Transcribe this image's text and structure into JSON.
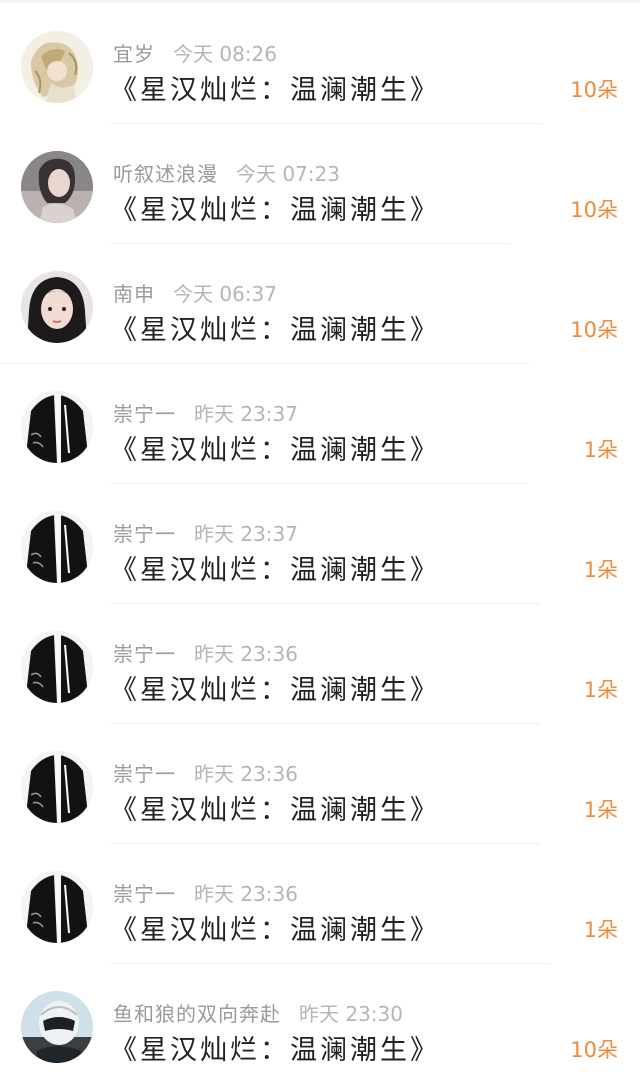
{
  "gifts": [
    {
      "user": "宜岁",
      "time": "今天 08:26",
      "title": "《星汉灿烂：温澜潮生》",
      "amount": "10朵",
      "avatar": "sketch-couple"
    },
    {
      "user": "听叙述浪漫",
      "time": "今天 07:23",
      "title": "《星汉灿烂：温澜潮生》",
      "amount": "10朵",
      "avatar": "girl-portrait"
    },
    {
      "user": "南申",
      "time": "今天 06:37",
      "title": "《星汉灿烂：温澜潮生》",
      "amount": "10朵",
      "avatar": "girl-dark-hair"
    },
    {
      "user": "崇宁一",
      "time": "昨天 23:37",
      "title": "《星汉灿烂：温澜潮生》",
      "amount": "1朵",
      "avatar": "black-robe"
    },
    {
      "user": "崇宁一",
      "time": "昨天 23:37",
      "title": "《星汉灿烂：温澜潮生》",
      "amount": "1朵",
      "avatar": "black-robe"
    },
    {
      "user": "崇宁一",
      "time": "昨天 23:36",
      "title": "《星汉灿烂：温澜潮生》",
      "amount": "1朵",
      "avatar": "black-robe"
    },
    {
      "user": "崇宁一",
      "time": "昨天 23:36",
      "title": "《星汉灿烂：温澜潮生》",
      "amount": "1朵",
      "avatar": "black-robe"
    },
    {
      "user": "崇宁一",
      "time": "昨天 23:36",
      "title": "《星汉灿烂：温澜潮生》",
      "amount": "1朵",
      "avatar": "black-robe"
    },
    {
      "user": "鱼和狼的双向奔赴",
      "time": "昨天 23:30",
      "title": "《星汉灿烂：温澜潮生》",
      "amount": "10朵",
      "avatar": "helmet-rider"
    }
  ],
  "colors": {
    "amount": "#f08a3c",
    "username": "#9a9a9a",
    "title": "#222222"
  }
}
